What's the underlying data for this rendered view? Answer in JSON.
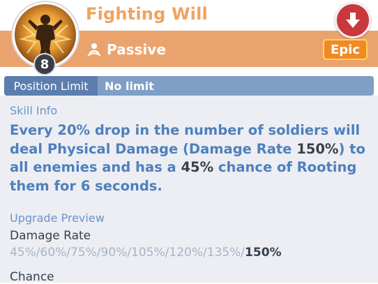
{
  "skill": {
    "name": "Fighting Will",
    "type": "Passive",
    "level": "8",
    "rarity": "Epic"
  },
  "position_limit": {
    "label": "Position Limit",
    "value": "No limit"
  },
  "skill_info": {
    "label": "Skill Info",
    "description": {
      "part1": "Every 20% drop in the number of soldiers will deal Physical Damage (Damage Rate ",
      "damage_rate": "150%",
      "part2": ") to all enemies and has a ",
      "chance": "45%",
      "part3": " chance of Rooting them for 6 seconds."
    }
  },
  "upgrade_preview": {
    "label": "Upgrade Preview",
    "damage_rate": {
      "label": "Damage Rate",
      "values": "45%/60%/75%/90%/105%/120%/135%/",
      "current": "150%"
    },
    "chance_label": "Chance"
  },
  "colors": {
    "title": "#f0a35d",
    "band": "#eba36d",
    "epic": "#f08a26",
    "description": "#4f7fbd",
    "down_button": "#c9383d"
  },
  "icons": {
    "portrait": "warrior-portrait-icon",
    "passive": "passive-skill-icon",
    "down": "down-arrow-icon"
  }
}
